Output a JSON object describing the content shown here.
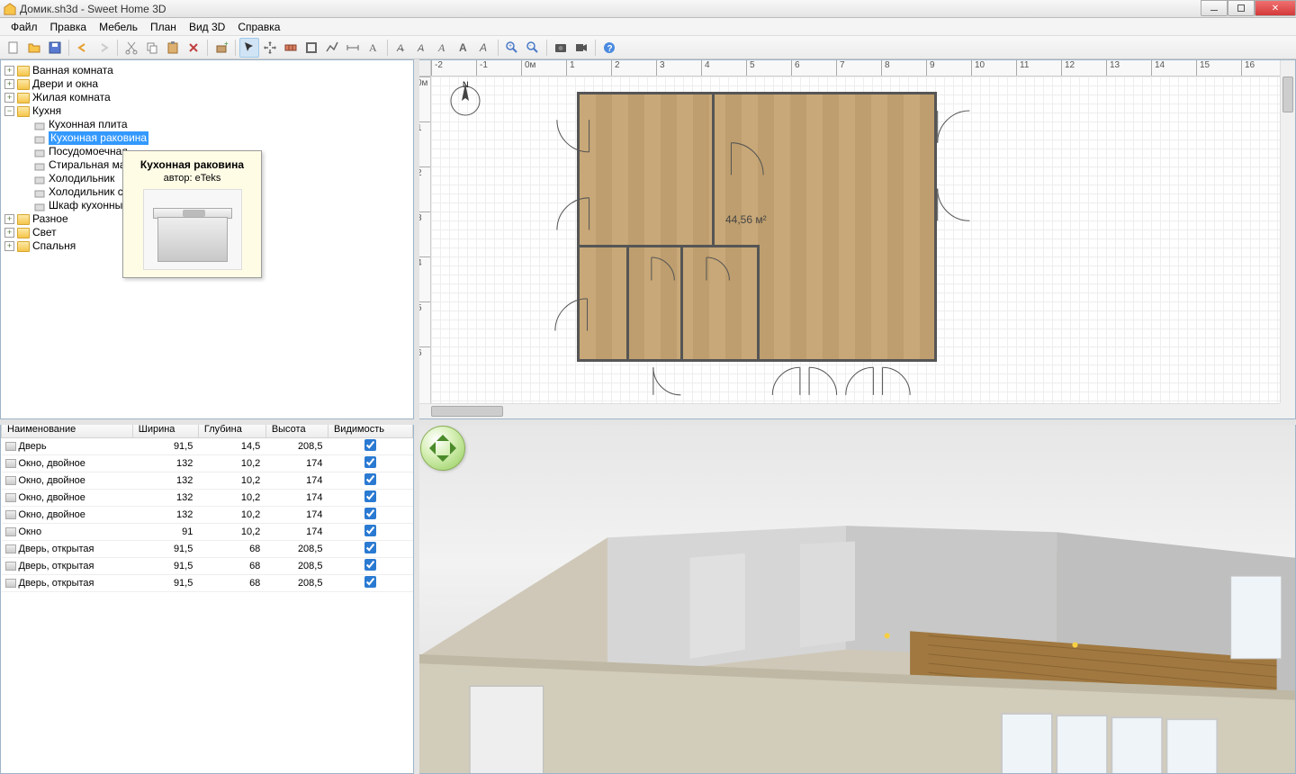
{
  "window_title": "Домик.sh3d - Sweet Home 3D",
  "menu": {
    "file": "Файл",
    "edit": "Правка",
    "furniture": "Мебель",
    "plan": "План",
    "view3d": "Вид 3D",
    "help": "Справка"
  },
  "tree": {
    "bathroom": "Ванная комната",
    "doors_windows": "Двери и окна",
    "living_room": "Жилая комната",
    "kitchen": "Кухня",
    "kitchen_items": {
      "stove": "Кухонная плита",
      "sink": "Кухонная раковина",
      "dishwasher": "Посудомоечная",
      "washer": "Стиральная ма",
      "fridge": "Холодильник",
      "fridge2": "Холодильник с",
      "cabinet": "Шкаф кухонны"
    },
    "misc": "Разное",
    "light": "Свет",
    "bedroom": "Спальня"
  },
  "tooltip": {
    "title": "Кухонная раковина",
    "author_label": "автор:",
    "author": "eTeks"
  },
  "plan": {
    "area_label": "44,56 м²",
    "ruler_h": [
      "-2",
      "-1",
      "0м",
      "1",
      "2",
      "3",
      "4",
      "5",
      "6",
      "7",
      "8",
      "9",
      "10",
      "11",
      "12",
      "13",
      "14",
      "15",
      "16"
    ],
    "ruler_v": [
      "0м",
      "1",
      "2",
      "3",
      "4",
      "5",
      "6"
    ],
    "compass_n": "N"
  },
  "table": {
    "columns": {
      "name": "Наименование",
      "width": "Ширина",
      "depth": "Глубина",
      "height": "Высота",
      "visibility": "Видимость"
    },
    "rows": [
      {
        "name": "Дверь",
        "w": "91,5",
        "d": "14,5",
        "h": "208,5",
        "v": true
      },
      {
        "name": "Окно, двойное",
        "w": "132",
        "d": "10,2",
        "h": "174",
        "v": true
      },
      {
        "name": "Окно, двойное",
        "w": "132",
        "d": "10,2",
        "h": "174",
        "v": true
      },
      {
        "name": "Окно, двойное",
        "w": "132",
        "d": "10,2",
        "h": "174",
        "v": true
      },
      {
        "name": "Окно, двойное",
        "w": "132",
        "d": "10,2",
        "h": "174",
        "v": true
      },
      {
        "name": "Окно",
        "w": "91",
        "d": "10,2",
        "h": "174",
        "v": true
      },
      {
        "name": "Дверь, открытая",
        "w": "91,5",
        "d": "68",
        "h": "208,5",
        "v": true
      },
      {
        "name": "Дверь, открытая",
        "w": "91,5",
        "d": "68",
        "h": "208,5",
        "v": true
      },
      {
        "name": "Дверь, открытая",
        "w": "91,5",
        "d": "68",
        "h": "208,5",
        "v": true
      }
    ]
  }
}
